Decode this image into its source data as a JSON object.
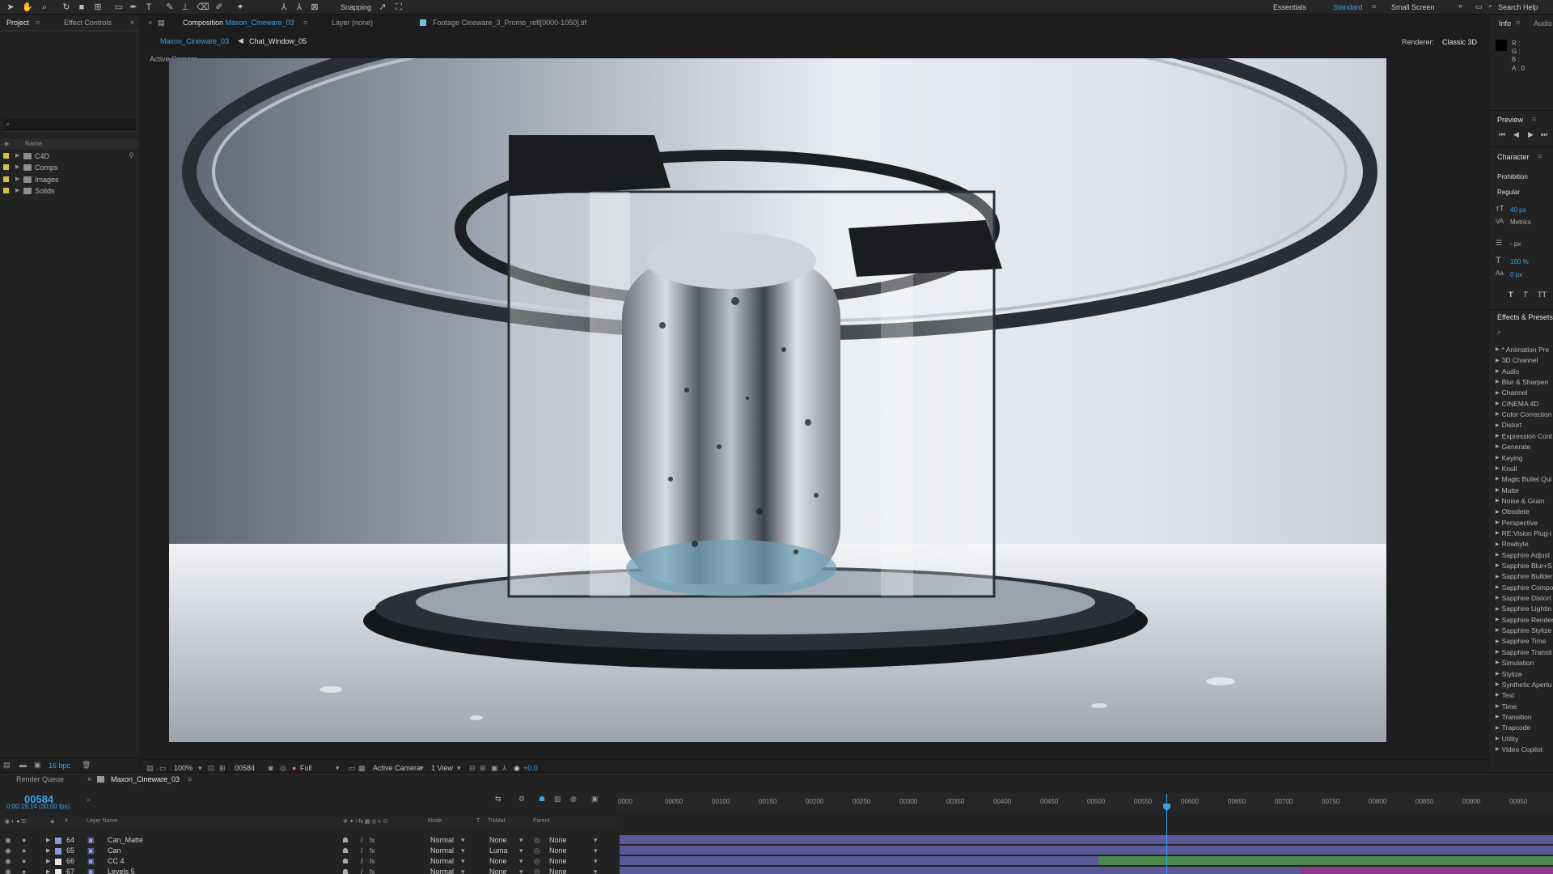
{
  "toolbar": {
    "snapping_label": "Snapping",
    "workspaces": [
      "Essentials",
      "Standard",
      "Small Screen"
    ],
    "active_workspace": "Standard",
    "search_help": "Search Help"
  },
  "project_panel": {
    "tabs": [
      "Project",
      "Effect Controls"
    ],
    "column_name": "Name",
    "folders": [
      "C4D",
      "Comps",
      "Images",
      "Solids"
    ],
    "bpc": "16 bpc"
  },
  "viewer": {
    "tabs": {
      "composition_prefix": "Composition",
      "composition_name": "Maxon_Cineware_03",
      "layer": "Layer (none)",
      "footage": "Footage Cineware_3_Promo_refl[0000-1050].tif"
    },
    "breadcrumbs": [
      "Maxon_Cineware_03",
      "Chat_Window_05"
    ],
    "renderer_label": "Renderer:",
    "renderer_value": "Classic 3D",
    "active_camera_label": "Active Camera",
    "bottom_bar": {
      "zoom": "100%",
      "frame": "00584",
      "resolution": "Full",
      "camera": "Active Camera",
      "views": "1 View",
      "exposure": "+0.0"
    }
  },
  "right_panel": {
    "info_tab": "Info",
    "audio_tab": "Audio",
    "info_values": [
      "R :",
      "G :",
      "B :",
      "A : 0"
    ],
    "preview_title": "Preview",
    "character_title": "Character",
    "font_family": "Prohibition",
    "font_style": "Regular",
    "font_size": "40 px",
    "kerning": "Metrics",
    "leading": "- px",
    "scale": "100 %",
    "baseline": "0 px",
    "effects_title": "Effects & Presets",
    "effects": [
      "* Animation Pre",
      "3D Channel",
      "Audio",
      "Blur & Sharpen",
      "Channel",
      "CINEMA 4D",
      "Color Correction",
      "Distort",
      "Expression Cont",
      "Generate",
      "Keying",
      "Knoll",
      "Magic Bullet Qui",
      "Matte",
      "Noise & Grain",
      "Obsolete",
      "Perspective",
      "RE:Vision Plug-i",
      "Rowbyte",
      "Sapphire Adjust",
      "Sapphire Blur+S",
      "Sapphire Builder",
      "Sapphire Compo",
      "Sapphire Distort",
      "Sapphire Lightin",
      "Sapphire Render",
      "Sapphire Stylize",
      "Sapphire Time",
      "Sapphire Transit",
      "Simulation",
      "Stylize",
      "Synthetic Apertu",
      "Text",
      "Time",
      "Transition",
      "Trapcode",
      "Utility",
      "Video Copilot"
    ]
  },
  "timeline": {
    "tabs": [
      "Render Queue",
      "Maxon_Cineware_03"
    ],
    "timecode": "00584",
    "timecode_sub": "0:00:19:14 (30.00 fps)",
    "columns": [
      "#",
      "Layer Name",
      "Mode",
      "T",
      "TrkMat",
      "Parent"
    ],
    "ruler_ticks": [
      "0000",
      "00050",
      "00100",
      "00150",
      "00200",
      "00250",
      "00300",
      "00350",
      "00400",
      "00450",
      "00500",
      "00550",
      "00600",
      "00650",
      "00700",
      "00750",
      "00800",
      "00850",
      "00900",
      "00950"
    ],
    "layers": [
      {
        "num": "64",
        "name": "Can_Matte",
        "mode": "Normal",
        "trkmat": "None",
        "parent": "None"
      },
      {
        "num": "65",
        "name": "Can",
        "mode": "Normal",
        "trkmat": "Luma",
        "parent": "None"
      },
      {
        "num": "66",
        "name": "CC 4",
        "mode": "Normal",
        "trkmat": "None",
        "parent": "None"
      },
      {
        "num": "67",
        "name": "Levels 5",
        "mode": "Normal",
        "trkmat": "None",
        "parent": "None"
      }
    ]
  },
  "colors": {
    "accent": "#3aa0e8",
    "panel_bg": "#232323",
    "label_yellow": "#d8c23a",
    "bar_purple": "#5a5a9a",
    "bar_green": "#4a8a4a",
    "bar_magenta": "#8a3a8a"
  }
}
